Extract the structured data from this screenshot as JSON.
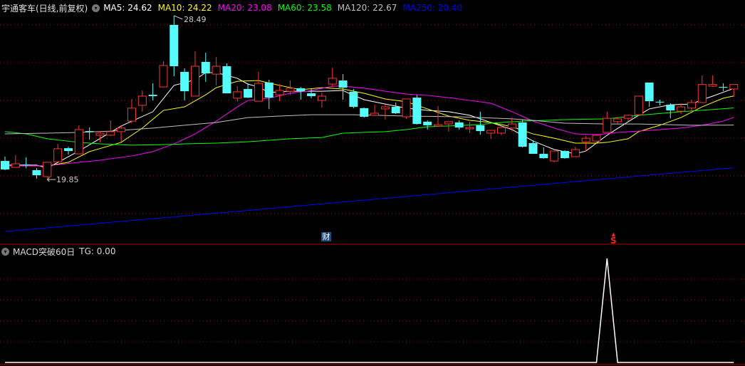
{
  "header": {
    "title": "宇通客车(日线,前复权)",
    "ma": [
      {
        "label": "MA5: 24.62",
        "color": "#ffffff"
      },
      {
        "label": "MA10: 24.22",
        "color": "#ffff00"
      },
      {
        "label": "MA20: 23.08",
        "color": "#ff00ff"
      },
      {
        "label": "MA60: 23.58",
        "color": "#00ff00"
      },
      {
        "label": "MA120: 22.67",
        "color": "#c0c0c0"
      },
      {
        "label": "MA250: 20.40",
        "color": "#0000ff"
      }
    ]
  },
  "indicator": {
    "title": "MACD突破60日",
    "value_label": "TG: 0.00"
  },
  "markers": {
    "finance": "财",
    "signal": "S"
  },
  "annotations": {
    "high": "28.49",
    "low": "19.85"
  },
  "colors": {
    "up": "#ff3232",
    "down": "#54fcfc",
    "grid": "#a01010",
    "border": "#b00000",
    "tg": "#ffffff"
  },
  "chart_data": {
    "type": "candlestick",
    "candles": [
      [
        20.76,
        20.99,
        20.27,
        20.31
      ],
      [
        20.42,
        21.07,
        20.42,
        20.61
      ],
      [
        20.57,
        20.95,
        20.38,
        20.54
      ],
      [
        20.27,
        20.38,
        19.82,
        20.0
      ],
      [
        19.93,
        20.69,
        19.85,
        20.69
      ],
      [
        20.72,
        21.67,
        20.69,
        21.41
      ],
      [
        21.44,
        21.52,
        21.1,
        21.29
      ],
      [
        21.14,
        22.66,
        21.14,
        22.43
      ],
      [
        22.35,
        22.54,
        21.9,
        22.32
      ],
      [
        22.13,
        22.35,
        21.75,
        22.24
      ],
      [
        22.13,
        22.92,
        22.09,
        22.32
      ],
      [
        22.32,
        22.66,
        21.78,
        22.51
      ],
      [
        22.88,
        24.06,
        22.77,
        23.57
      ],
      [
        23.72,
        24.51,
        23.38,
        24.21
      ],
      [
        24.28,
        24.89,
        23.98,
        24.21
      ],
      [
        24.7,
        26.07,
        24.7,
        25.84
      ],
      [
        28.0,
        28.49,
        25.27,
        25.8
      ],
      [
        25.5,
        25.69,
        23.98,
        24.47
      ],
      [
        24.21,
        26.6,
        24.21,
        25.8
      ],
      [
        26.03,
        26.52,
        24.97,
        25.42
      ],
      [
        25.38,
        26.29,
        24.78,
        25.8
      ],
      [
        25.8,
        25.95,
        24.36,
        24.36
      ],
      [
        24.1,
        24.74,
        23.91,
        24.44
      ],
      [
        24.59,
        24.89,
        24.1,
        24.13
      ],
      [
        23.94,
        25.5,
        23.94,
        24.89
      ],
      [
        24.93,
        25.08,
        23.53,
        24.13
      ],
      [
        24.28,
        24.85,
        23.94,
        24.51
      ],
      [
        24.47,
        25.04,
        24.28,
        24.63
      ],
      [
        24.63,
        24.7,
        24.02,
        24.47
      ],
      [
        24.36,
        24.59,
        24.1,
        24.21
      ],
      [
        23.98,
        24.4,
        23.6,
        24.21
      ],
      [
        24.85,
        25.72,
        24.7,
        25.16
      ],
      [
        25.04,
        25.38,
        24.02,
        24.66
      ],
      [
        24.44,
        24.59,
        23.57,
        23.64
      ],
      [
        23.57,
        23.6,
        23.07,
        23.11
      ],
      [
        23.19,
        23.75,
        23.15,
        23.3
      ],
      [
        23.53,
        23.75,
        22.96,
        23.64
      ],
      [
        23.64,
        23.87,
        23.26,
        23.3
      ],
      [
        23.11,
        24.06,
        23.0,
        24.06
      ],
      [
        24.13,
        24.28,
        22.69,
        22.73
      ],
      [
        22.85,
        22.92,
        22.43,
        22.66
      ],
      [
        22.62,
        23.68,
        22.62,
        22.69
      ],
      [
        22.73,
        22.85,
        22.32,
        22.85
      ],
      [
        22.81,
        22.92,
        22.43,
        22.54
      ],
      [
        22.47,
        22.85,
        22.24,
        22.54
      ],
      [
        22.66,
        23.38,
        22.16,
        22.35
      ],
      [
        22.24,
        22.39,
        21.94,
        22.39
      ],
      [
        22.24,
        22.54,
        22.13,
        22.54
      ],
      [
        22.51,
        23.07,
        22.32,
        22.73
      ],
      [
        22.81,
        22.96,
        21.48,
        21.52
      ],
      [
        21.71,
        21.86,
        21.14,
        21.14
      ],
      [
        21.14,
        21.48,
        20.88,
        20.91
      ],
      [
        20.76,
        21.29,
        20.69,
        21.29
      ],
      [
        21.29,
        21.33,
        20.88,
        20.91
      ],
      [
        20.99,
        21.52,
        20.99,
        21.37
      ],
      [
        21.78,
        22.09,
        21.29,
        21.97
      ],
      [
        21.82,
        22.2,
        21.75,
        22.13
      ],
      [
        22.28,
        23.38,
        22.28,
        23.03
      ],
      [
        22.85,
        23.11,
        22.73,
        23.0
      ],
      [
        23.03,
        23.22,
        22.88,
        23.19
      ],
      [
        23.22,
        24.21,
        23.22,
        24.21
      ],
      [
        24.93,
        24.93,
        23.64,
        23.94
      ],
      [
        23.91,
        24.02,
        23.72,
        23.87
      ],
      [
        23.75,
        23.83,
        23.03,
        23.45
      ],
      [
        23.41,
        23.83,
        23.26,
        23.64
      ],
      [
        23.57,
        24.02,
        23.41,
        23.87
      ],
      [
        23.87,
        25.31,
        23.87,
        24.83
      ],
      [
        24.74,
        25.31,
        24.7,
        24.83
      ],
      [
        24.7,
        24.89,
        24.47,
        24.66
      ],
      [
        24.59,
        24.85,
        24.17,
        24.83
      ]
    ],
    "candle_format": [
      "open",
      "high",
      "low",
      "close"
    ],
    "ylim": [
      16.5,
      29.0
    ],
    "ma_series": [
      {
        "name": "MA5",
        "color": "#ffffff",
        "points": [
          [
            0,
            20.54
          ],
          [
            3,
            20.54
          ],
          [
            4,
            20.38
          ],
          [
            7,
            21.29
          ],
          [
            11,
            22.62
          ],
          [
            14,
            23.38
          ],
          [
            16,
            24.78
          ],
          [
            18,
            25.08
          ],
          [
            19,
            25.46
          ],
          [
            20,
            25.46
          ],
          [
            22,
            25.16
          ],
          [
            23,
            24.85
          ],
          [
            24,
            24.7
          ],
          [
            25,
            24.4
          ],
          [
            27,
            24.47
          ],
          [
            30,
            24.47
          ],
          [
            32,
            24.51
          ],
          [
            33,
            24.25
          ],
          [
            34,
            24.02
          ],
          [
            36,
            23.79
          ],
          [
            38,
            23.57
          ],
          [
            40,
            23.45
          ],
          [
            42,
            23.38
          ],
          [
            44,
            23.19
          ],
          [
            46,
            22.81
          ],
          [
            48,
            22.43
          ],
          [
            50,
            21.82
          ],
          [
            52,
            21.37
          ],
          [
            54,
            21.14
          ],
          [
            55,
            21.29
          ],
          [
            57,
            22.13
          ],
          [
            59,
            22.85
          ],
          [
            61,
            23.53
          ],
          [
            63,
            23.75
          ],
          [
            65,
            23.79
          ],
          [
            66,
            24.02
          ],
          [
            67,
            24.21
          ],
          [
            69,
            24.62
          ]
        ]
      },
      {
        "name": "MA10",
        "color": "#ffff00",
        "points": [
          [
            0,
            20.5
          ],
          [
            4,
            20.5
          ],
          [
            6,
            20.69
          ],
          [
            8,
            21.26
          ],
          [
            11,
            21.75
          ],
          [
            13,
            22.51
          ],
          [
            15,
            23.45
          ],
          [
            17,
            23.64
          ],
          [
            19,
            24.28
          ],
          [
            20,
            24.66
          ],
          [
            22,
            25.0
          ],
          [
            24,
            25.04
          ],
          [
            26,
            24.78
          ],
          [
            28,
            24.55
          ],
          [
            30,
            24.66
          ],
          [
            32,
            24.59
          ],
          [
            34,
            24.36
          ],
          [
            36,
            24.06
          ],
          [
            38,
            23.91
          ],
          [
            40,
            23.53
          ],
          [
            42,
            23.15
          ],
          [
            44,
            22.92
          ],
          [
            46,
            22.81
          ],
          [
            48,
            22.58
          ],
          [
            50,
            22.2
          ],
          [
            52,
            21.97
          ],
          [
            54,
            21.71
          ],
          [
            56,
            21.71
          ],
          [
            57,
            21.75
          ],
          [
            59,
            21.94
          ],
          [
            60,
            22.32
          ],
          [
            62,
            22.66
          ],
          [
            64,
            23.07
          ],
          [
            66,
            23.64
          ],
          [
            68,
            24.1
          ],
          [
            69,
            24.22
          ]
        ]
      },
      {
        "name": "MA20",
        "color": "#ff00ff",
        "points": [
          [
            0,
            20.5
          ],
          [
            4,
            20.5
          ],
          [
            7,
            20.69
          ],
          [
            9,
            20.8
          ],
          [
            12,
            21.03
          ],
          [
            14,
            21.26
          ],
          [
            16,
            21.67
          ],
          [
            18,
            22.2
          ],
          [
            20,
            22.88
          ],
          [
            22,
            23.64
          ],
          [
            23,
            23.98
          ],
          [
            25,
            24.1
          ],
          [
            27,
            24.36
          ],
          [
            29,
            24.51
          ],
          [
            31,
            24.74
          ],
          [
            32,
            24.74
          ],
          [
            34,
            24.63
          ],
          [
            36,
            24.47
          ],
          [
            38,
            24.32
          ],
          [
            40,
            24.25
          ],
          [
            42,
            24.13
          ],
          [
            44,
            23.98
          ],
          [
            46,
            23.83
          ],
          [
            48,
            23.38
          ],
          [
            50,
            22.88
          ],
          [
            52,
            22.51
          ],
          [
            54,
            22.2
          ],
          [
            56,
            22.16
          ],
          [
            58,
            22.28
          ],
          [
            60,
            22.35
          ],
          [
            62,
            22.43
          ],
          [
            64,
            22.51
          ],
          [
            66,
            22.66
          ],
          [
            68,
            22.88
          ],
          [
            69,
            23.08
          ]
        ]
      },
      {
        "name": "MA60",
        "color": "#00ff00",
        "points": [
          [
            0,
            22.32
          ],
          [
            2,
            22.2
          ],
          [
            4,
            21.94
          ],
          [
            7,
            21.75
          ],
          [
            9,
            21.67
          ],
          [
            12,
            21.6
          ],
          [
            15,
            21.63
          ],
          [
            17,
            21.67
          ],
          [
            20,
            21.71
          ],
          [
            23,
            21.78
          ],
          [
            25,
            21.86
          ],
          [
            27,
            21.94
          ],
          [
            30,
            22.01
          ],
          [
            32,
            22.24
          ],
          [
            36,
            22.32
          ],
          [
            38,
            22.43
          ],
          [
            40,
            22.58
          ],
          [
            45,
            22.69
          ],
          [
            46,
            22.77
          ],
          [
            49,
            22.88
          ],
          [
            53,
            22.96
          ],
          [
            57,
            23.0
          ],
          [
            60,
            23.19
          ],
          [
            64,
            23.38
          ],
          [
            69,
            23.58
          ]
        ]
      },
      {
        "name": "MA120",
        "color": "#c0c0c0",
        "points": [
          [
            0,
            22.2
          ],
          [
            4,
            22.24
          ],
          [
            7,
            22.28
          ],
          [
            10,
            22.35
          ],
          [
            14,
            22.51
          ],
          [
            17,
            22.66
          ],
          [
            20,
            22.81
          ],
          [
            23,
            23.07
          ],
          [
            26,
            23.15
          ],
          [
            29,
            23.22
          ],
          [
            33,
            23.22
          ],
          [
            38,
            23.15
          ],
          [
            43,
            23.11
          ],
          [
            48,
            23.0
          ],
          [
            50,
            22.92
          ],
          [
            53,
            22.77
          ],
          [
            57,
            22.73
          ],
          [
            60,
            22.73
          ],
          [
            65,
            22.66
          ],
          [
            69,
            22.67
          ]
        ]
      },
      {
        "name": "MA250",
        "color": "#0000ff",
        "points": [
          [
            0,
            17.01
          ],
          [
            23,
            18.13
          ],
          [
            46,
            19.27
          ],
          [
            69,
            20.4
          ]
        ]
      }
    ],
    "tg": {
      "name": "TG",
      "values": [
        0,
        0,
        0,
        0,
        0,
        0,
        0,
        0,
        0,
        0,
        0,
        0,
        0,
        0,
        0,
        0,
        0,
        0,
        0,
        0,
        0,
        0,
        0,
        0,
        0,
        0,
        0,
        0,
        0,
        0,
        0,
        0,
        0,
        0,
        0,
        0,
        0,
        0,
        0,
        0,
        0,
        0,
        0,
        0,
        0,
        0,
        0,
        0,
        0,
        0,
        0,
        0,
        0,
        0,
        0,
        0,
        0,
        1,
        0,
        0,
        0,
        0,
        0,
        0,
        0,
        0,
        0,
        0,
        0,
        0
      ],
      "ylim": [
        0,
        1.14
      ]
    },
    "marker_index": {
      "finance": 30,
      "signal": 58
    },
    "high_index": 16,
    "low_index": 4
  }
}
